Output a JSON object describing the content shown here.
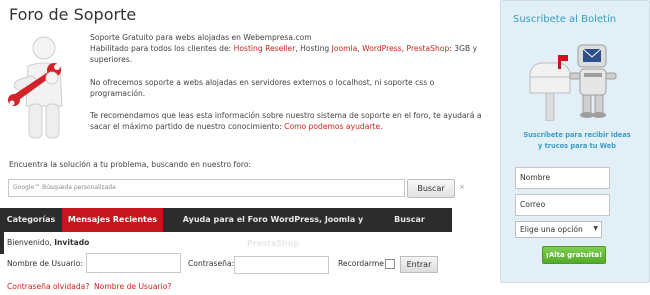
{
  "header": {
    "title": "Foro de Soporte"
  },
  "intro": {
    "line1": "Soporte Gratuito para webs alojadas en Webempresa.com",
    "line2_prefix": "Habilitado para todos los clientes de: ",
    "hosting_reseller": "Hosting Reseller",
    "sep1": ", Hosting ",
    "joomla": "Joomla",
    "sep2": ", ",
    "wordpress": "WordPress",
    "sep3": ", ",
    "prestashop": "PrestaShop",
    "line2_suffix": ": 3GB y superiores.",
    "para2": "No ofrecemos soporte a webs alojadas en servidores externos o localhost, ni soporte css o programación.",
    "para3_prefix": "Te recomendamos que leas esta información sobre nuestro sistema de soporte en el foro, te ayudará a sacar el máximo partido de nuestro conocimiento: ",
    "para3_link": "Como podemos ayudarte",
    "para3_suffix": "."
  },
  "search": {
    "lead": "Encuentra la solución a tu problema, buscando en nuestro foro:",
    "brand": "Google™",
    "placeholder": "Búsqueda personalizada",
    "button": "Buscar",
    "clear": "×"
  },
  "tabs": [
    {
      "label": "Categorías"
    },
    {
      "label": "Mensajes Recientes"
    },
    {
      "label": "Ayuda para el Foro WordPress, Joomla y PrestaShop"
    },
    {
      "label": "Buscar"
    }
  ],
  "login": {
    "welcome_prefix": "Bienvenido, ",
    "welcome_user": "Invitado",
    "username_label": "Nombre de Usuario:",
    "password_label": "Contraseña:",
    "remember_label": "Recordarme",
    "enter_button": "Entrar",
    "forgot_password": "Contraseña olvidada?",
    "forgot_username": "Nombre de Usuario?"
  },
  "newsletter": {
    "title": "Suscríbete al Boletín",
    "text": "Suscríbete para recibir ideas y trucos para tu Web",
    "name_value": "Nombre",
    "email_value": "Correo",
    "select_value": "Elige una opción",
    "button": "¡Alta gratuita!"
  },
  "colors": {
    "accent_red": "#c4161c",
    "tabbar_dark": "#2c2c2c",
    "panel_bg": "#e2eff6",
    "panel_blue": "#3a9dc7",
    "button_green": "#52a929"
  }
}
